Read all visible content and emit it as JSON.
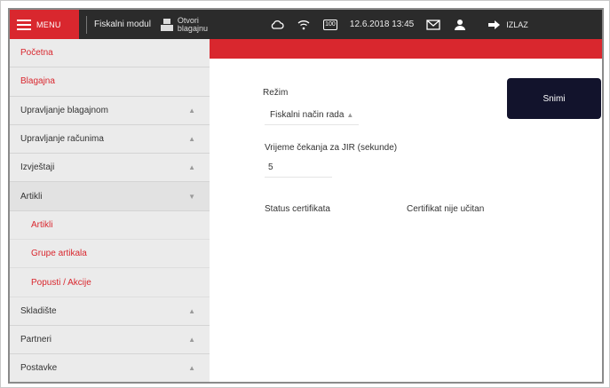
{
  "topbar": {
    "menu_label": "MENU",
    "module_name": "Fiskalni modul",
    "open_register_line1": "Otvori",
    "open_register_line2": "blagajnu",
    "battery": "100",
    "datetime": "12.6.2018 13:45",
    "exit_label": "IZLAZ"
  },
  "sidebar": {
    "items": [
      {
        "label": "Početna"
      },
      {
        "label": "Blagajna"
      },
      {
        "label": "Upravljanje blagajnom"
      },
      {
        "label": "Upravljanje računima"
      },
      {
        "label": "Izvještaji"
      },
      {
        "label": "Artikli"
      },
      {
        "label": "Artikli"
      },
      {
        "label": "Grupe artikala"
      },
      {
        "label": "Popusti / Akcije"
      },
      {
        "label": "Skladište"
      },
      {
        "label": "Partneri"
      },
      {
        "label": "Postavke"
      }
    ]
  },
  "main": {
    "mode_label": "Režim",
    "mode_value": "Fiskalni način rada",
    "jir_label": "Vrijeme čekanja za JIR (sekunde)",
    "jir_value": "5",
    "cert_label": "Status certifikata",
    "cert_value": "Certifikat nije učitan",
    "save_label": "Snimi"
  },
  "colors": {
    "accent": "#d9272e",
    "topbar": "#2b2b2b",
    "sidebar": "#ebebeb",
    "save_button": "#12132c"
  }
}
